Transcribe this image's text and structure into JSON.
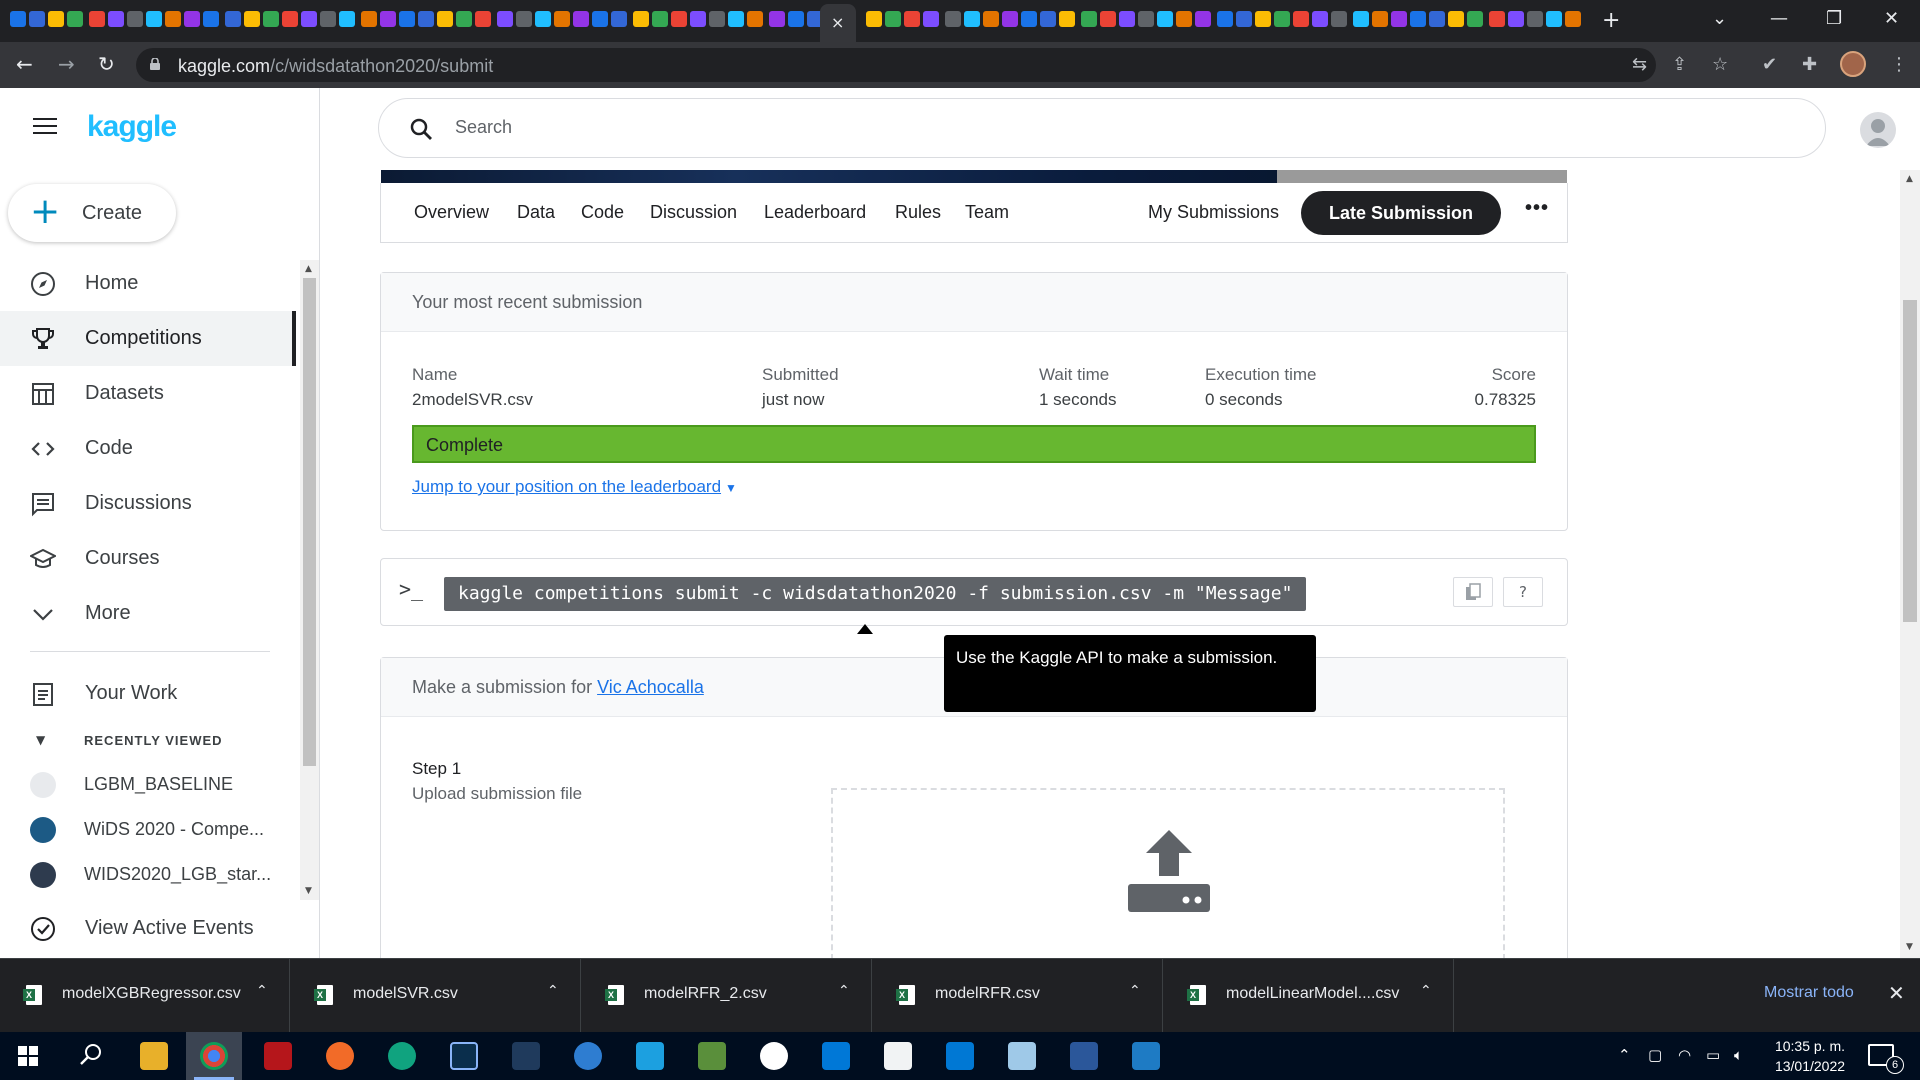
{
  "browser": {
    "url_host": "kaggle.com",
    "url_path": "/c/widsdatathon2020/submit",
    "tab_close": "×",
    "new_tab": "+"
  },
  "sidebar": {
    "logo": "kaggle",
    "create_label": "Create",
    "items": [
      {
        "label": "Home",
        "icon": "compass-icon"
      },
      {
        "label": "Competitions",
        "icon": "trophy-icon",
        "active": true
      },
      {
        "label": "Datasets",
        "icon": "table-icon"
      },
      {
        "label": "Code",
        "icon": "code-brackets-icon"
      },
      {
        "label": "Discussions",
        "icon": "discussion-icon"
      },
      {
        "label": "Courses",
        "icon": "graduation-cap-icon"
      },
      {
        "label": "More",
        "icon": "chevron-down-icon"
      }
    ],
    "your_work": "Your Work",
    "recently_viewed_heading": "RECENTLY VIEWED",
    "recent": [
      {
        "label": "LGBM_BASELINE"
      },
      {
        "label": "WiDS 2020 - Compe..."
      },
      {
        "label": "WIDS2020_LGB_star..."
      }
    ],
    "view_active_events": "View Active Events"
  },
  "search": {
    "placeholder": "Search"
  },
  "competition_nav": {
    "tabs": [
      "Overview",
      "Data",
      "Code",
      "Discussion",
      "Leaderboard",
      "Rules",
      "Team"
    ],
    "my_submissions": "My Submissions",
    "late_submission": "Late Submission",
    "more": "•••"
  },
  "recent_submission": {
    "heading": "Your most recent submission",
    "columns": {
      "name": "Name",
      "submitted": "Submitted",
      "wait_time": "Wait time",
      "execution_time": "Execution time",
      "score": "Score"
    },
    "values": {
      "name": "2modelSVR.csv",
      "submitted": "just now",
      "wait_time": "1 seconds",
      "execution_time": "0 seconds",
      "score": "0.78325"
    },
    "status": "Complete",
    "status_color": "#67b730",
    "jump_link": "Jump to your position on the leaderboard"
  },
  "api": {
    "prompt": ">_",
    "command": "kaggle competitions submit -c widsdatathon2020 -f submission.csv -m \"Message\"",
    "copy_icon": "clipboard-icon",
    "help_label": "?",
    "tooltip": "Use the Kaggle API to make a submission."
  },
  "make_submission": {
    "heading_prefix": "Make a submission for",
    "user": "Vic Achocalla",
    "step_title": "Step 1",
    "step_sub": "Upload submission file"
  },
  "downloads": {
    "files": [
      "modelXGBRegressor.csv",
      "modelSVR.csv",
      "modelRFR_2.csv",
      "modelRFR.csv",
      "modelLinearModel....csv"
    ],
    "show_all": "Mostrar todo",
    "close": "✕"
  },
  "taskbar": {
    "time": "10:35 p. m.",
    "date": "13/01/2022",
    "notifications": "6"
  },
  "colors": {
    "kaggle_blue": "#20beff",
    "link_blue": "#1a73e8",
    "complete_green": "#67b730"
  }
}
